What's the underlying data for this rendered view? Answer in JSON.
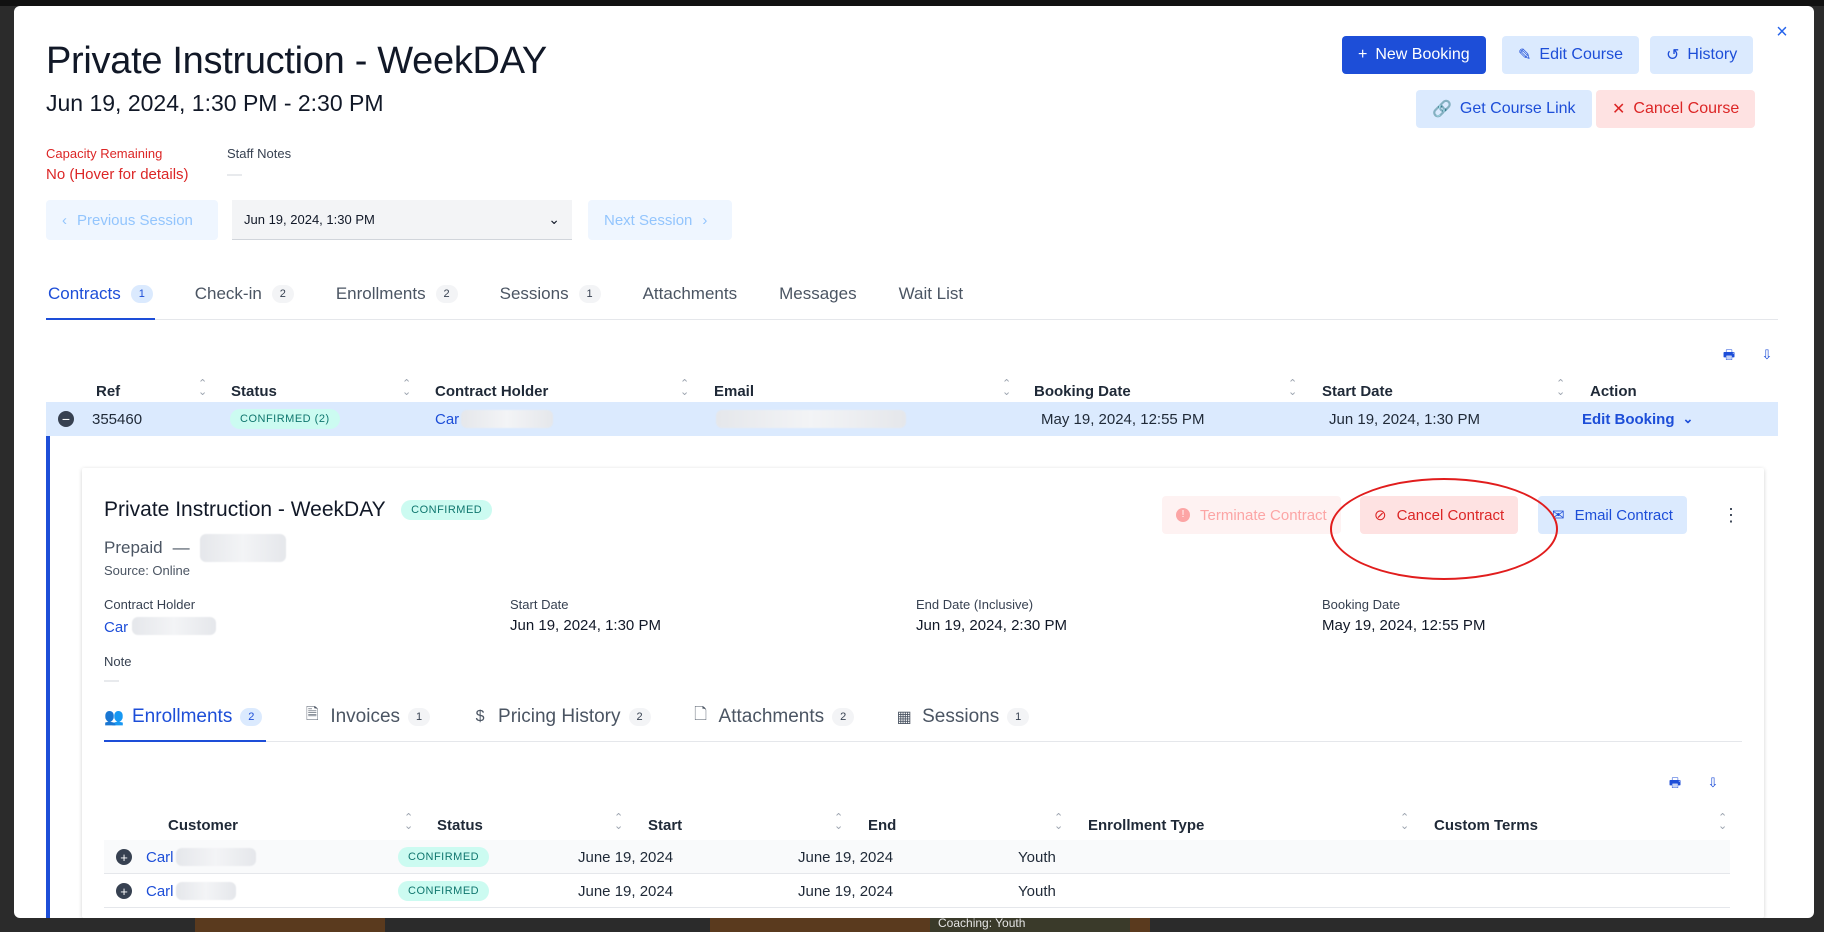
{
  "modal": {
    "title": "Private Instruction - WeekDAY",
    "subtitle": "Jun 19, 2024, 1:30 PM - 2:30 PM",
    "close_icon": "×",
    "buttons": {
      "new_booking": "New Booking",
      "edit_course": "Edit Course",
      "history": "History",
      "get_course_link": "Get Course Link",
      "cancel_course": "Cancel Course"
    },
    "capacity_label": "Capacity Remaining",
    "capacity_value": "No (Hover for details)",
    "staff_notes_label": "Staff Notes",
    "staff_notes_value": "—",
    "session_nav": {
      "previous": "Previous Session",
      "selected": "Jun 19, 2024, 1:30 PM",
      "next": "Next Session"
    },
    "tabs": [
      {
        "label": "Contracts",
        "count": "1"
      },
      {
        "label": "Check-in",
        "count": "2"
      },
      {
        "label": "Enrollments",
        "count": "2"
      },
      {
        "label": "Sessions",
        "count": "1"
      },
      {
        "label": "Attachments",
        "count": ""
      },
      {
        "label": "Messages",
        "count": ""
      },
      {
        "label": "Wait List",
        "count": ""
      }
    ]
  },
  "contracts_table": {
    "headers": [
      "Ref",
      "Status",
      "Contract Holder",
      "Email",
      "Booking Date",
      "Start Date",
      "Action"
    ],
    "row": {
      "ref": "355460",
      "status": "CONFIRMED (2)",
      "holder": "Car",
      "email": "",
      "booking_date": "May 19, 2024, 12:55 PM",
      "start_date": "Jun 19, 2024, 1:30 PM",
      "action": "Edit Booking"
    }
  },
  "contract_detail": {
    "title": "Private Instruction - WeekDAY",
    "status": "CONFIRMED",
    "payment": "Prepaid",
    "payment_sep": "—",
    "source": "Source: Online",
    "buttons": {
      "terminate": "Terminate Contract",
      "cancel": "Cancel Contract",
      "email": "Email Contract"
    },
    "fields": {
      "holder_label": "Contract Holder",
      "holder_value": "Car",
      "start_label": "Start Date",
      "start_value": "Jun 19, 2024, 1:30 PM",
      "end_label": "End Date (Inclusive)",
      "end_value": "Jun 19, 2024, 2:30 PM",
      "booking_label": "Booking Date",
      "booking_value": "May 19, 2024, 12:55 PM",
      "note_label": "Note",
      "note_value": "—"
    },
    "subtabs": [
      {
        "label": "Enrollments",
        "count": "2",
        "icon": "people-icon"
      },
      {
        "label": "Invoices",
        "count": "1",
        "icon": "document-icon"
      },
      {
        "label": "Pricing History",
        "count": "2",
        "icon": "dollar-icon"
      },
      {
        "label": "Attachments",
        "count": "2",
        "icon": "file-icon"
      },
      {
        "label": "Sessions",
        "count": "1",
        "icon": "calendar-icon"
      }
    ],
    "enrollments": {
      "headers": [
        "Customer",
        "Status",
        "Start",
        "End",
        "Enrollment Type",
        "Custom Terms"
      ],
      "rows": [
        {
          "customer": "Carl",
          "status": "CONFIRMED",
          "start": "June 19, 2024",
          "end": "June 19, 2024",
          "type": "Youth",
          "terms": ""
        },
        {
          "customer": "Carl",
          "status": "CONFIRMED",
          "start": "June 19, 2024",
          "end": "June 19, 2024",
          "type": "Youth",
          "terms": ""
        }
      ]
    }
  },
  "backdrop": {
    "text": "Coaching: Youth"
  },
  "colors": {
    "accent": "#1d4ed8",
    "danger": "#dc2626",
    "confirmed_bg": "#ccfbf1"
  }
}
